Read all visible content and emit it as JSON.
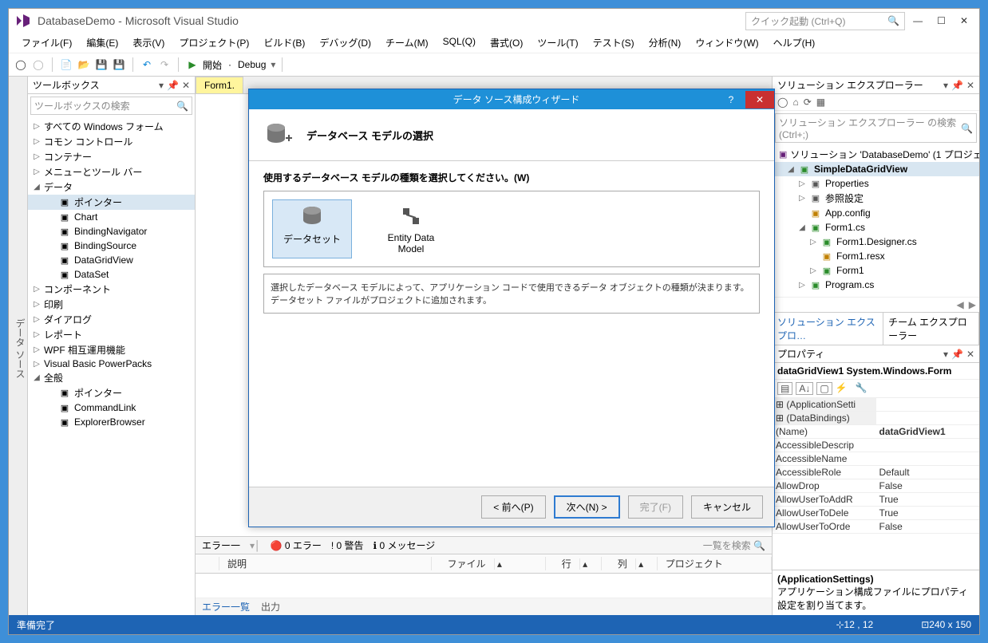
{
  "window": {
    "title": "DatabaseDemo - Microsoft Visual Studio",
    "quick_launch_placeholder": "クイック起動 (Ctrl+Q)"
  },
  "menu": {
    "file": "ファイル(F)",
    "edit": "編集(E)",
    "view": "表示(V)",
    "project": "プロジェクト(P)",
    "build": "ビルド(B)",
    "debug": "デバッグ(D)",
    "team": "チーム(M)",
    "sql": "SQL(Q)",
    "format": "書式(O)",
    "tools": "ツール(T)",
    "test": "テスト(S)",
    "analyze": "分析(N)",
    "window": "ウィンドウ(W)",
    "help": "ヘルプ(H)"
  },
  "toolbar": {
    "start": "開始",
    "config": "Debug"
  },
  "toolbox": {
    "title": "ツールボックス",
    "search_placeholder": "ツールボックスの検索",
    "items": [
      {
        "expand": "▷",
        "label": "すべての Windows フォーム",
        "indent": 0
      },
      {
        "expand": "▷",
        "label": "コモン コントロール",
        "indent": 0
      },
      {
        "expand": "▷",
        "label": "コンテナー",
        "indent": 0
      },
      {
        "expand": "▷",
        "label": "メニューとツール バー",
        "indent": 0
      },
      {
        "expand": "◢",
        "label": "データ",
        "indent": 0
      },
      {
        "expand": "",
        "icon": "ptr",
        "label": "ポインター",
        "indent": 1,
        "selected": true
      },
      {
        "expand": "",
        "icon": "chart",
        "label": "Chart",
        "indent": 1
      },
      {
        "expand": "",
        "icon": "nav",
        "label": "BindingNavigator",
        "indent": 1
      },
      {
        "expand": "",
        "icon": "bsrc",
        "label": "BindingSource",
        "indent": 1
      },
      {
        "expand": "",
        "icon": "grid",
        "label": "DataGridView",
        "indent": 1
      },
      {
        "expand": "",
        "icon": "dset",
        "label": "DataSet",
        "indent": 1
      },
      {
        "expand": "▷",
        "label": "コンポーネント",
        "indent": 0
      },
      {
        "expand": "▷",
        "label": "印刷",
        "indent": 0
      },
      {
        "expand": "▷",
        "label": "ダイアログ",
        "indent": 0
      },
      {
        "expand": "▷",
        "label": "レポート",
        "indent": 0
      },
      {
        "expand": "▷",
        "label": "WPF 相互運用機能",
        "indent": 0
      },
      {
        "expand": "▷",
        "label": "Visual Basic PowerPacks",
        "indent": 0
      },
      {
        "expand": "◢",
        "label": "全般",
        "indent": 0
      },
      {
        "expand": "",
        "icon": "ptr",
        "label": "ポインター",
        "indent": 1
      },
      {
        "expand": "",
        "icon": "cmd",
        "label": "CommandLink",
        "indent": 1
      },
      {
        "expand": "",
        "icon": "exp",
        "label": "ExplorerBrowser",
        "indent": 1
      }
    ]
  },
  "left_dock_tab": "データ ソース",
  "doc_tab": "Form1.",
  "error_list": {
    "title": "エラー一",
    "filter_errors": "0 エラー",
    "filter_warnings": "! 0 警告",
    "filter_messages": "0 メッセージ",
    "search_hint": "一覧を検索",
    "cols": [
      "",
      "説明",
      "ファイル",
      "行",
      "列",
      "プロジェクト"
    ]
  },
  "bottom_tabs": {
    "errors": "エラー一覧",
    "output": "出力"
  },
  "solution": {
    "title": "ソリューション エクスプローラー",
    "search_placeholder": "ソリューション エクスプローラー の検索 (Ctrl+;)",
    "nodes": [
      {
        "expand": "",
        "icon": "sln",
        "label": "ソリューション 'DatabaseDemo' (1 プロジェ",
        "indent": 0
      },
      {
        "expand": "◢",
        "icon": "csproj",
        "label": "SimpleDataGridView",
        "indent": 1,
        "bold": true,
        "selected": true
      },
      {
        "expand": "▷",
        "icon": "wrench",
        "label": "Properties",
        "indent": 2
      },
      {
        "expand": "▷",
        "icon": "ref",
        "label": "参照設定",
        "indent": 2
      },
      {
        "expand": "",
        "icon": "cfg",
        "label": "App.config",
        "indent": 2
      },
      {
        "expand": "◢",
        "icon": "form",
        "label": "Form1.cs",
        "indent": 2
      },
      {
        "expand": "▷",
        "icon": "cs",
        "label": "Form1.Designer.cs",
        "indent": 3
      },
      {
        "expand": "",
        "icon": "resx",
        "label": "Form1.resx",
        "indent": 3
      },
      {
        "expand": "▷",
        "icon": "cs",
        "label": "Form1",
        "indent": 3
      },
      {
        "expand": "▷",
        "icon": "cs",
        "label": "Program.cs",
        "indent": 2
      }
    ],
    "tab_active": "ソリューション エクスプロ…",
    "tab_other": "チーム エクスプローラー"
  },
  "props": {
    "title": "プロパティ",
    "obj": "dataGridView1  System.Windows.Form",
    "cats": [
      {
        "type": "cat",
        "k": "(ApplicationSetti"
      },
      {
        "type": "cat",
        "k": "(DataBindings)"
      },
      {
        "k": "(Name)",
        "v": "dataGridView1",
        "bold": true
      },
      {
        "k": "AccessibleDescrip",
        "v": ""
      },
      {
        "k": "AccessibleName",
        "v": ""
      },
      {
        "k": "AccessibleRole",
        "v": "Default"
      },
      {
        "k": "AllowDrop",
        "v": "False"
      },
      {
        "k": "AllowUserToAddR",
        "v": "True"
      },
      {
        "k": "AllowUserToDele",
        "v": "True"
      },
      {
        "k": "AllowUserToOrde",
        "v": "False"
      }
    ],
    "desc_title": "(ApplicationSettings)",
    "desc_body": "アプリケーション構成ファイルにプロパティ設定を割り当てます。"
  },
  "status": {
    "ready": "準備完了",
    "pos": "12 , 12",
    "size": "240 x 150"
  },
  "dialog": {
    "title": "データ ソース構成ウィザード",
    "header": "データベース モデルの選択",
    "instr": "使用するデータベース モデルの種類を選択してください。(W)",
    "opt1": "データセット",
    "opt2": "Entity Data Model",
    "desc": "選択したデータベース モデルによって、アプリケーション コードで使用できるデータ オブジェクトの種類が決まります。データセット ファイルがプロジェクトに追加されます。",
    "back": "< 前へ(P)",
    "next": "次へ(N) >",
    "finish": "完了(F)",
    "cancel": "キャンセル"
  }
}
